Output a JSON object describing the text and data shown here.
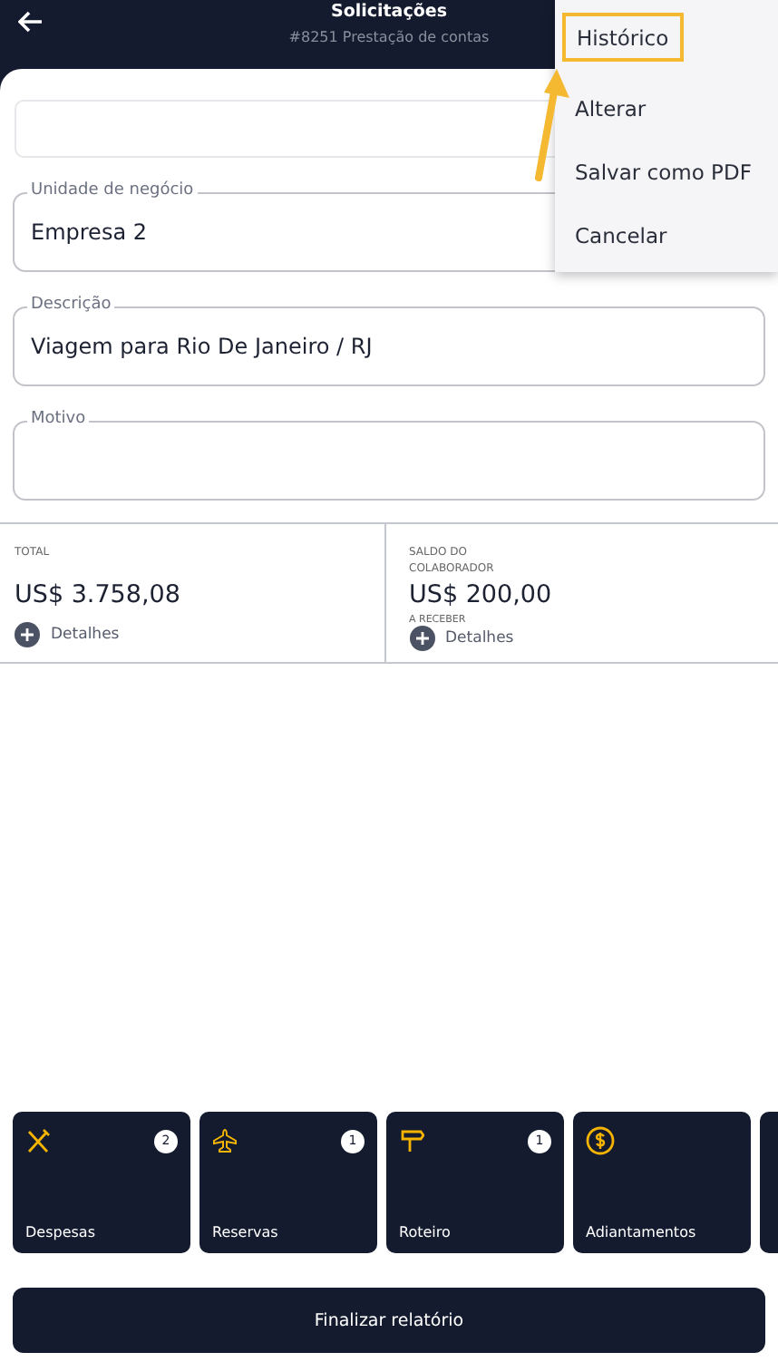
{
  "header": {
    "title": "Solicitações",
    "subtitle": "#8251 Prestação de contas"
  },
  "menu": {
    "items": [
      {
        "label": "Histórico",
        "highlighted": true
      },
      {
        "label": "Alterar",
        "highlighted": false
      },
      {
        "label": "Salvar como PDF",
        "highlighted": false
      },
      {
        "label": "Cancelar",
        "highlighted": false
      }
    ]
  },
  "fields": [
    {
      "label": "Unidade de negócio",
      "value": "Empresa 2"
    },
    {
      "label": "Descrição",
      "value": "Viagem para Rio De Janeiro / RJ"
    },
    {
      "label": "Motivo"
    }
  ],
  "summary": [
    {
      "label": "TOTAL",
      "amount": "US$ 3.758,08",
      "details": "Detalhes"
    },
    {
      "label": "SALDO DO COLABORADOR",
      "amount": "US$ 200,00",
      "note": "A RECEBER",
      "details": "Detalhes"
    }
  ],
  "tiles": [
    {
      "kind": "cutlery",
      "label": "Despesas",
      "count": "2"
    },
    {
      "kind": "plane",
      "label": "Reservas",
      "count": "1"
    },
    {
      "kind": "signpost",
      "label": "Roteiro",
      "count": "1"
    },
    {
      "kind": "coin",
      "label": "Adiantamentos"
    },
    {
      "kind": "partial"
    }
  ],
  "finish_button": "Finalizar relatório"
}
